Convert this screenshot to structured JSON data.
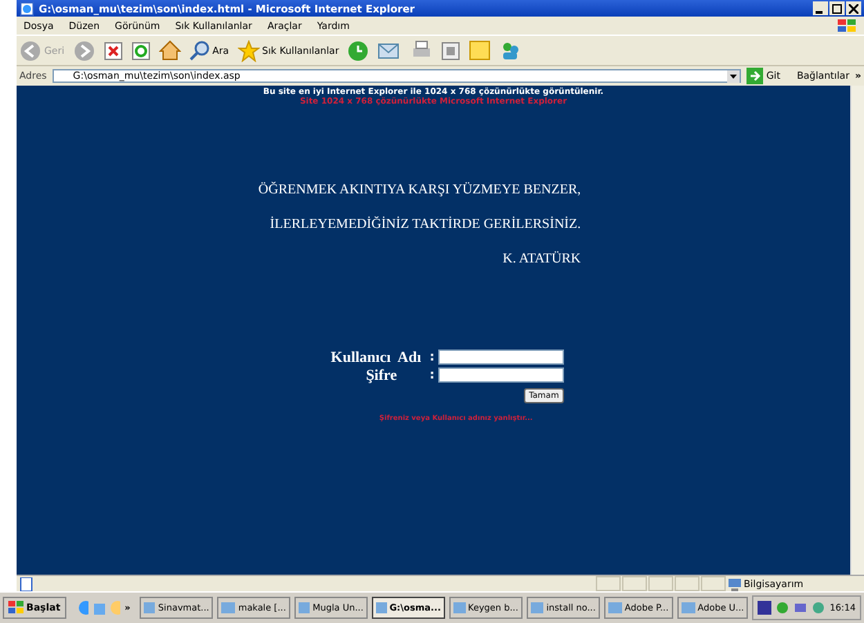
{
  "window": {
    "title": "G:\\osman_mu\\tezim\\son\\index.html - Microsoft Internet Explorer"
  },
  "menu": [
    "Dosya",
    "Düzen",
    "Görünüm",
    "Sık Kullanılanlar",
    "Araçlar",
    "Yardım"
  ],
  "toolbar": {
    "back": "Geri",
    "search": "Ara",
    "favorites": "Sık Kullanılanlar"
  },
  "address": {
    "label": "Adres",
    "value": "G:\\osman_mu\\tezim\\son\\index.asp",
    "go": "Git",
    "links": "Bağlantılar",
    "more": "»"
  },
  "page": {
    "notice": "Bu site en iyi Internet Explorer ile 1024 x 768 çözünürlükte görüntülenir.",
    "notice_red": "Site 1024 x 768 çözünürlükte Microsoft Internet Explorer",
    "quote": [
      "ÖĞRENMEK AKINTIYA KARŞI YÜZMEYE BENZER,",
      "İLERLEYEMEDİĞİNİZ TAKTİRDE GERİLERSİNİZ."
    ],
    "author": "K. ATATÜRK",
    "username_label": "Kullanıcı  Adı",
    "password_label": "Şifre",
    "colon": ":",
    "submit": "Tamam",
    "error": "Şifreniz veya Kullanıcı adınız yanlıştır..."
  },
  "status_bar": {
    "zone": "Bilgisayarım"
  },
  "taskbar": {
    "start": "Başlat",
    "more": "»",
    "clock": "16:14",
    "items": [
      {
        "label": "Sinavmat...",
        "selected": false
      },
      {
        "label": "makale [...",
        "selected": false
      },
      {
        "label": "Mugla Un...",
        "selected": false
      },
      {
        "label": "G:\\osma...",
        "selected": true
      },
      {
        "label": "Keygen b...",
        "selected": false
      },
      {
        "label": "install no...",
        "selected": false
      },
      {
        "label": "Adobe P...",
        "selected": false
      },
      {
        "label": "Adobe U...",
        "selected": false
      }
    ]
  }
}
